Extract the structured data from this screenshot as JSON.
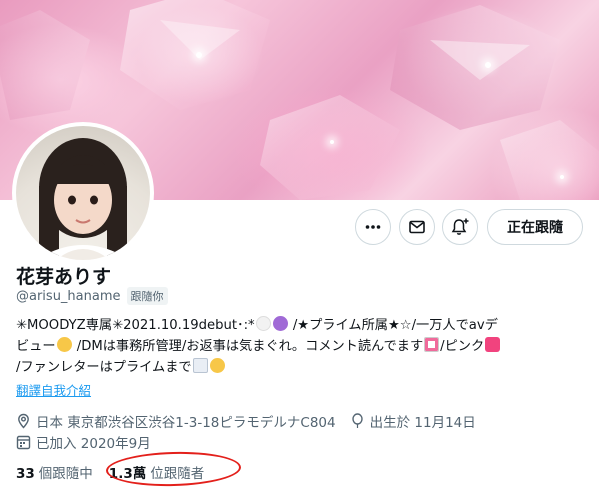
{
  "colors": {
    "accent": "#1d9bf0",
    "annotation_circle": "#e3201b"
  },
  "banner": {
    "description": "pink-crystal-banner"
  },
  "profile": {
    "name": "花芽ありす",
    "handle": "@arisu_haname",
    "follows_you_badge": "跟隨你"
  },
  "actions": {
    "more_icon": "more-horizontal-icon",
    "message_icon": "mail-icon",
    "notify_icon": "bell-plus-icon",
    "following_label": "正在跟隨"
  },
  "bio": {
    "line1_a": "✳MOODYZ専属✳2021.10.19debut･:*",
    "line1_b": " /★プライム所属★☆/一万人でavデ",
    "line2_a": "ビュー",
    "line2_b": " /DMは事務所管理/お返事は気まぐれ。コメント読んでます",
    "line2_c": "/ピンク",
    "line3_a": "/ファンレターはプライムまで",
    "translate_link": "翻譯自我介紹"
  },
  "meta": {
    "location": "日本 東京都渋谷区渋谷1-3-18ピラモデルナC804",
    "birthday": "出生於 11月14日",
    "joined": "已加入 2020年9月"
  },
  "stats": {
    "following_count": "33",
    "following_label": "個跟隨中",
    "followers_count": "1.3萬",
    "followers_label": "位跟隨者"
  }
}
